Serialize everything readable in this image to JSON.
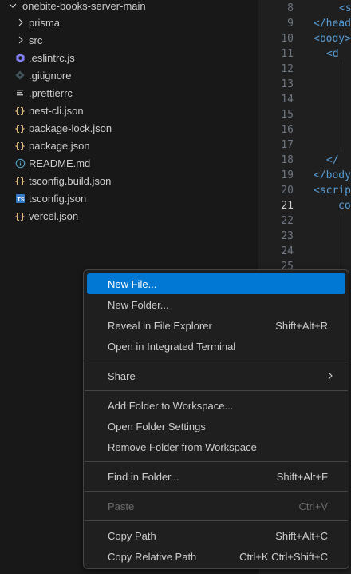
{
  "explorer": {
    "root": "onebite-books-server-main",
    "folders": [
      "prisma",
      "src"
    ],
    "files": [
      {
        "name": ".eslintrc.js",
        "icon": "eslint-icon",
        "color": "#8080f2"
      },
      {
        "name": ".gitignore",
        "icon": "git-icon",
        "color": "#41535b"
      },
      {
        "name": ".prettierrc",
        "icon": "lines-icon",
        "color": "#bbbbbb"
      },
      {
        "name": "nest-cli.json",
        "icon": "json-icon",
        "color": "#e5c07b"
      },
      {
        "name": "package-lock.json",
        "icon": "json-icon",
        "color": "#e5c07b"
      },
      {
        "name": "package.json",
        "icon": "json-icon",
        "color": "#e5c07b"
      },
      {
        "name": "README.md",
        "icon": "info-icon",
        "color": "#519aba"
      },
      {
        "name": "tsconfig.build.json",
        "icon": "json-icon",
        "color": "#e5c07b"
      },
      {
        "name": "tsconfig.json",
        "icon": "ts-icon",
        "color": "#3178c6"
      },
      {
        "name": "vercel.json",
        "icon": "json-icon",
        "color": "#e5c07b"
      }
    ]
  },
  "editor": {
    "line_numbers": [
      "8",
      "9",
      "10",
      "11",
      "12",
      "13",
      "14",
      "15",
      "16",
      "17",
      "18",
      "19",
      "20",
      "21",
      "22",
      "23",
      "24",
      "25"
    ],
    "active_line": "21",
    "code": {
      "l8": "<s",
      "l9": "</head",
      "l10": "<body>",
      "l11": "<d",
      "l18": "</",
      "l19": "</body",
      "l20": "<scrip",
      "l21": "co"
    }
  },
  "context_menu": {
    "items": [
      {
        "label": "New File...",
        "shortcut": ""
      },
      {
        "label": "New Folder...",
        "shortcut": ""
      },
      {
        "label": "Reveal in File Explorer",
        "shortcut": "Shift+Alt+R"
      },
      {
        "label": "Open in Integrated Terminal",
        "shortcut": ""
      },
      {
        "label": "Share",
        "shortcut": ""
      },
      {
        "label": "Add Folder to Workspace...",
        "shortcut": ""
      },
      {
        "label": "Open Folder Settings",
        "shortcut": ""
      },
      {
        "label": "Remove Folder from Workspace",
        "shortcut": ""
      },
      {
        "label": "Find in Folder...",
        "shortcut": "Shift+Alt+F"
      },
      {
        "label": "Paste",
        "shortcut": "Ctrl+V"
      },
      {
        "label": "Copy Path",
        "shortcut": "Shift+Alt+C"
      },
      {
        "label": "Copy Relative Path",
        "shortcut": "Ctrl+K Ctrl+Shift+C"
      }
    ],
    "highlight_color": "#0078d4"
  }
}
